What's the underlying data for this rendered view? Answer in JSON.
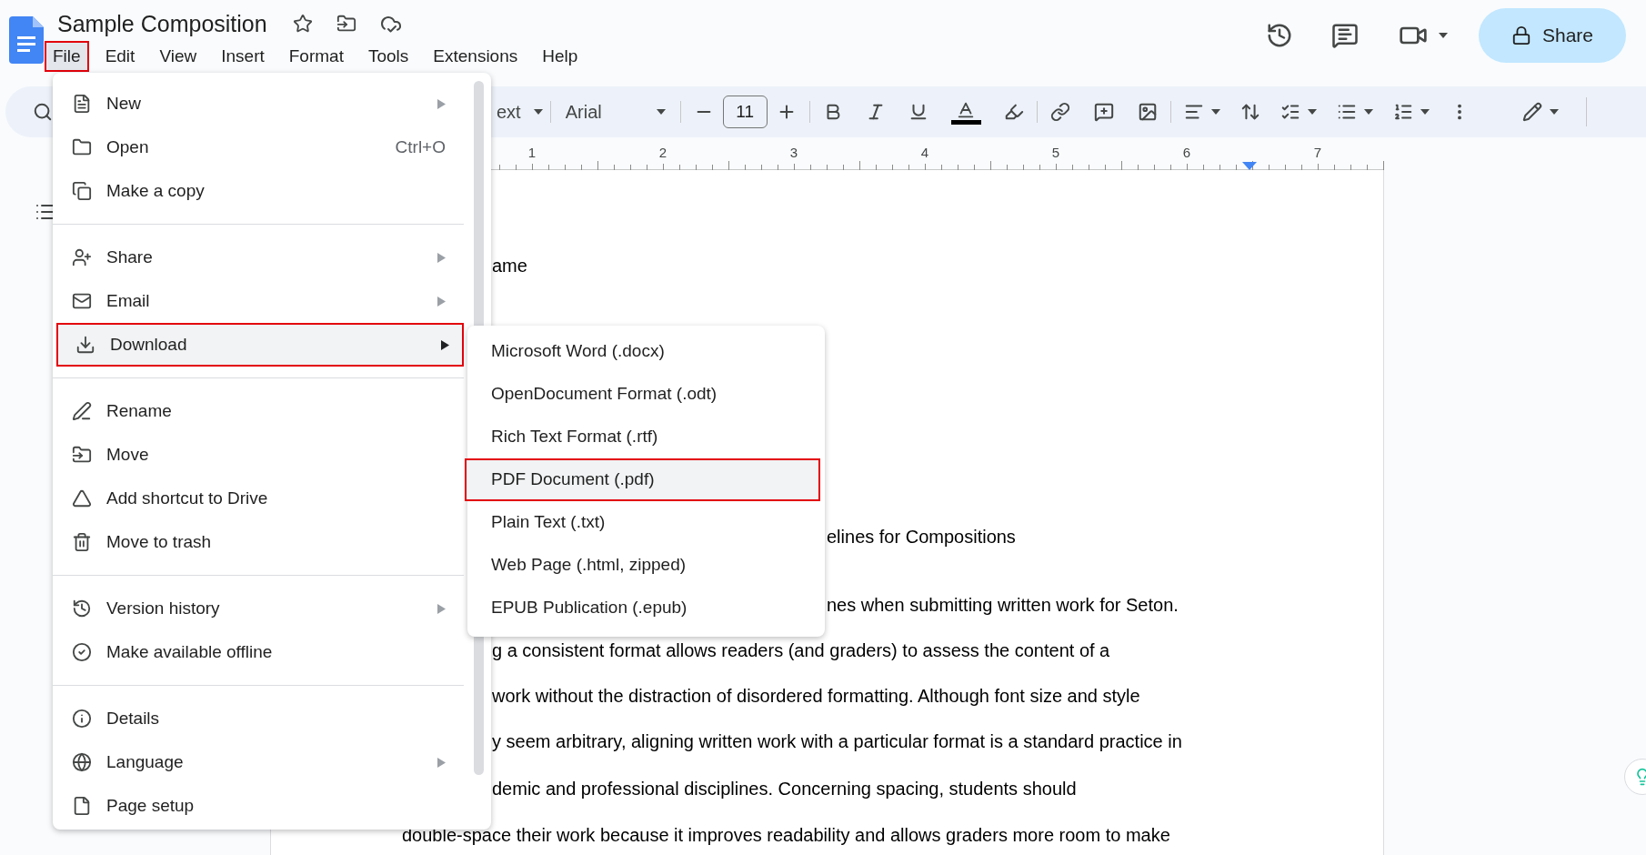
{
  "document": {
    "title": "Sample Composition"
  },
  "menubar": [
    {
      "label": "File",
      "selected": true
    },
    {
      "label": "Edit",
      "selected": false
    },
    {
      "label": "View",
      "selected": false
    },
    {
      "label": "Insert",
      "selected": false
    },
    {
      "label": "Format",
      "selected": false
    },
    {
      "label": "Tools",
      "selected": false
    },
    {
      "label": "Extensions",
      "selected": false
    },
    {
      "label": "Help",
      "selected": false
    }
  ],
  "share_button": {
    "label": "Share"
  },
  "toolbar": {
    "style_fragment": "ext",
    "font": "Arial",
    "font_size": "11"
  },
  "ruler": {
    "marks": [
      "1",
      "2",
      "3",
      "4",
      "5",
      "6",
      "7"
    ]
  },
  "file_menu": {
    "groups": [
      [
        {
          "label": "New",
          "has_submenu": true,
          "selected": false
        },
        {
          "label": "Open",
          "shortcut": "Ctrl+O",
          "has_submenu": false,
          "selected": false
        },
        {
          "label": "Make a copy",
          "has_submenu": false,
          "selected": false
        }
      ],
      [
        {
          "label": "Share",
          "has_submenu": true,
          "selected": false
        },
        {
          "label": "Email",
          "has_submenu": true,
          "selected": false
        },
        {
          "label": "Download",
          "has_submenu": true,
          "selected": true
        }
      ],
      [
        {
          "label": "Rename",
          "has_submenu": false,
          "selected": false
        },
        {
          "label": "Move",
          "has_submenu": false,
          "selected": false
        },
        {
          "label": "Add shortcut to Drive",
          "has_submenu": false,
          "selected": false
        },
        {
          "label": "Move to trash",
          "has_submenu": false,
          "selected": false
        }
      ],
      [
        {
          "label": "Version history",
          "has_submenu": true,
          "selected": false
        },
        {
          "label": "Make available offline",
          "has_submenu": false,
          "selected": false
        }
      ],
      [
        {
          "label": "Details",
          "has_submenu": false,
          "selected": false
        },
        {
          "label": "Language",
          "has_submenu": true,
          "selected": false
        },
        {
          "label": "Page setup",
          "has_submenu": false,
          "selected": false
        }
      ]
    ]
  },
  "download_submenu": {
    "items": [
      {
        "label": "Microsoft Word (.docx)",
        "selected": false
      },
      {
        "label": "OpenDocument Format (.odt)",
        "selected": false
      },
      {
        "label": "Rich Text Format (.rtf)",
        "selected": false
      },
      {
        "label": "PDF Document (.pdf)",
        "selected": true
      },
      {
        "label": "Plain Text (.txt)",
        "selected": false
      },
      {
        "label": "Web Page (.html, zipped)",
        "selected": false
      },
      {
        "label": "EPUB Publication (.epub)",
        "selected": false
      }
    ]
  },
  "document_text": [
    "ame",
    "elines for Compositions",
    "nes when submitting written work for Seton.",
    "g a consistent format allows readers (and graders) to assess the content of a",
    "work without the distraction of disordered formatting. Although font size and style",
    "y seem arbitrary, aligning written work with a particular format is a standard practice in",
    "demic and professional disciplines. Concerning spacing, students should",
    "double-space their work because it improves readability and allows graders more room to make"
  ]
}
